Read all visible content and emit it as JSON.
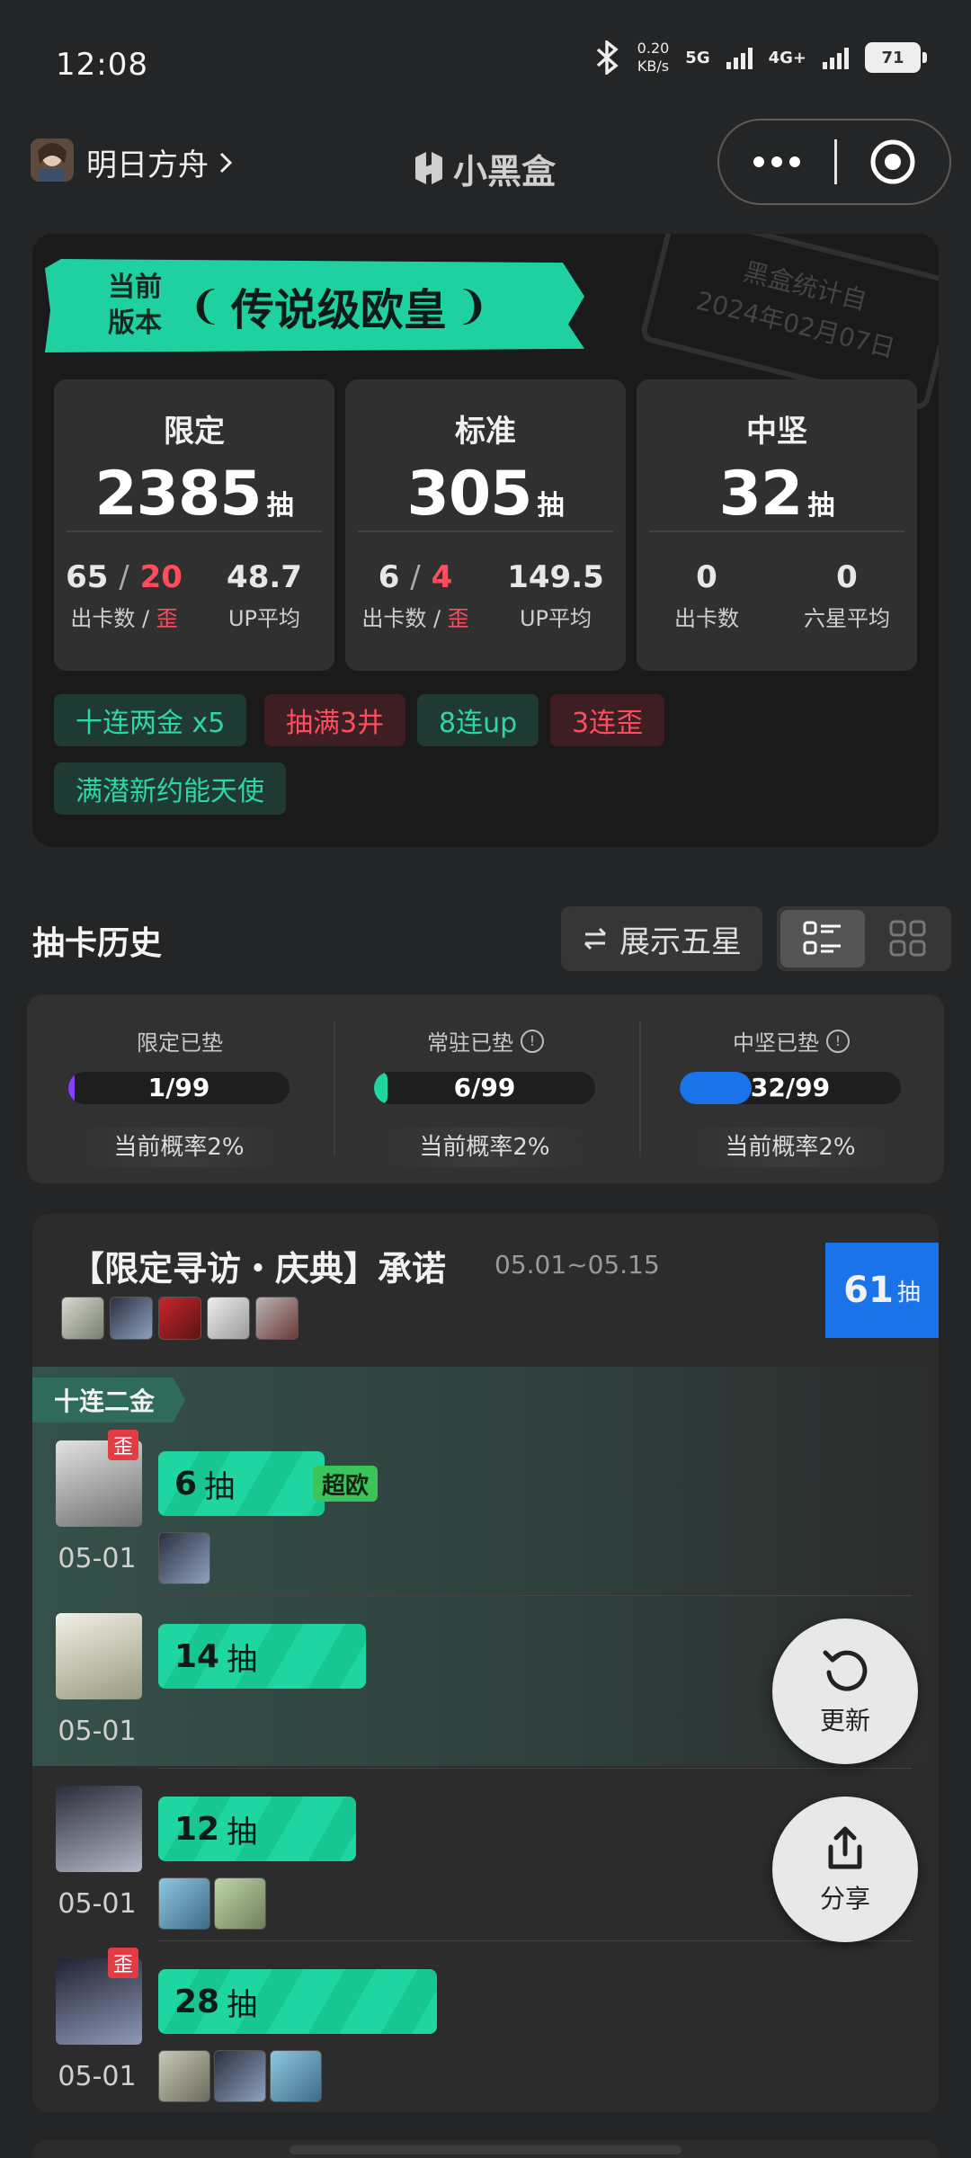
{
  "status_bar": {
    "time": "12:08",
    "speed_value": "0.20",
    "speed_unit": "KB/s",
    "net1": "5G",
    "net2": "4G+",
    "battery": "71"
  },
  "header": {
    "game_name": "明日方舟",
    "logo_text": "小黑盒"
  },
  "summary": {
    "version_label_1": "当前",
    "version_label_2": "版本",
    "title": "传说级欧皇",
    "stamp_line1": "黑盒统计自",
    "stamp_line2": "2024年02月07日",
    "stats": [
      {
        "title": "限定",
        "count": "2385",
        "unit": "抽",
        "a1": "65",
        "sep": "/",
        "a2": "20",
        "a_label": "出卡数 / ",
        "a_label_red": "歪",
        "b": "48.7",
        "b_label": "UP平均"
      },
      {
        "title": "标准",
        "count": "305",
        "unit": "抽",
        "a1": "6",
        "sep": "/",
        "a2": "4",
        "a_label": "出卡数 / ",
        "a_label_red": "歪",
        "b": "149.5",
        "b_label": "UP平均"
      },
      {
        "title": "中坚",
        "count": "32",
        "unit": "抽",
        "a1": "0",
        "a_label": "出卡数",
        "b": "0",
        "b_label": "六星平均"
      }
    ],
    "tags": [
      {
        "label": "十连两金  x5",
        "color": "green"
      },
      {
        "label": "抽满3井",
        "color": "red"
      },
      {
        "label": "8连up",
        "color": "green"
      },
      {
        "label": "3连歪",
        "color": "red"
      },
      {
        "label": "满潜新约能天使",
        "color": "green"
      }
    ]
  },
  "history": {
    "title": "抽卡历史",
    "toggle_label": "展示五星",
    "pity": [
      {
        "label": "限定已垫",
        "value": "1/99",
        "fraction": 0.0101,
        "rate": "当前概率2%",
        "info": false,
        "color": "#8a3cff"
      },
      {
        "label": "常驻已垫",
        "value": "6/99",
        "fraction": 0.0606,
        "rate": "当前概率2%",
        "info": true,
        "color": "#1fd6a3"
      },
      {
        "label": "中坚已垫",
        "value": "32/99",
        "fraction": 0.3232,
        "rate": "当前概率2%",
        "info": true,
        "color": "#1a73e8"
      }
    ]
  },
  "pool": {
    "title": "【限定寻访・庆典】承诺",
    "date_range": "05.01~05.15",
    "count": "61",
    "count_unit": "抽",
    "ribbon": "十连二金",
    "pulls": [
      {
        "pulls": "6",
        "unit": "抽",
        "date": "05-01",
        "wai": "歪",
        "badge": "超欧",
        "fill": 0.21
      },
      {
        "pulls": "14",
        "unit": "抽",
        "date": "05-01",
        "wai": "",
        "badge": "",
        "fill": 0.5
      },
      {
        "pulls": "12",
        "unit": "抽",
        "date": "05-01",
        "wai": "",
        "badge": "",
        "fill": 0.43
      },
      {
        "pulls": "28",
        "unit": "抽",
        "date": "05-01",
        "wai": "歪",
        "badge": "",
        "fill": 1.0
      }
    ]
  },
  "fabs": {
    "refresh": "更新",
    "share": "分享"
  }
}
